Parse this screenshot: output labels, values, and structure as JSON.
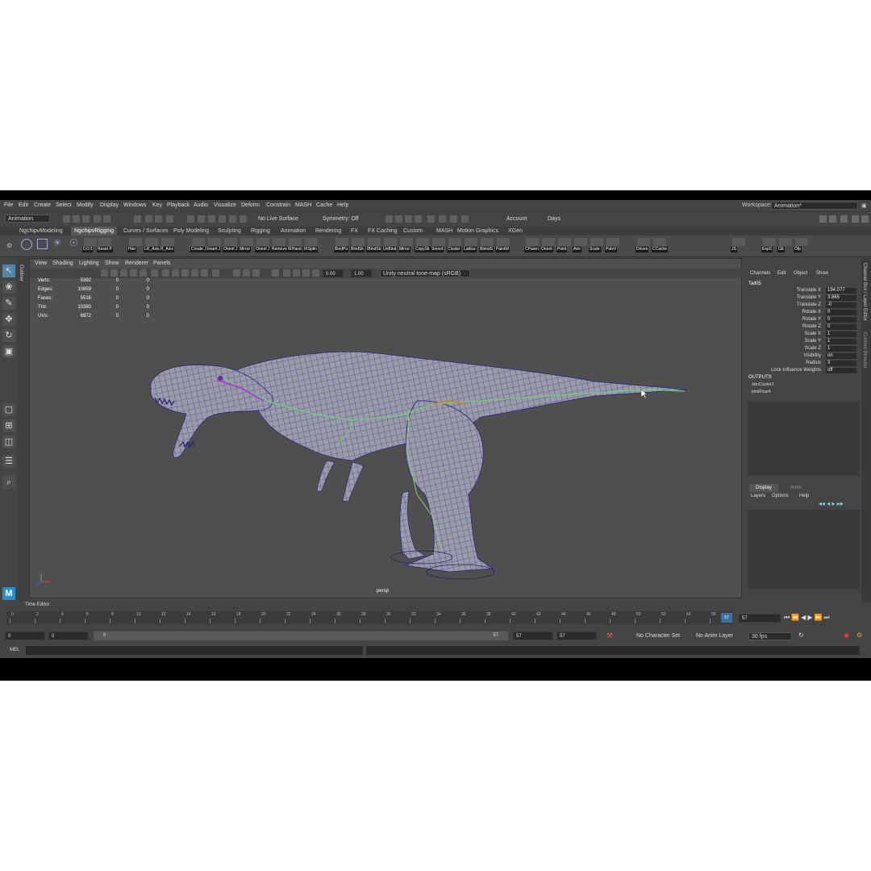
{
  "menu": [
    "File",
    "Edit",
    "Create",
    "Select",
    "Modify",
    "Display",
    "Windows",
    "Key",
    "Playback",
    "Audio",
    "Visualize",
    "Deform",
    "Constrain",
    "MASH",
    "Cache",
    "Help"
  ],
  "workspace": {
    "label": "Workspace:",
    "value": "Animation*"
  },
  "status": {
    "mode": "Animation",
    "live_surface": "No Live Surface",
    "symmetry": "Symmetry: Off",
    "account": "Account",
    "days": "Days"
  },
  "shelf_tabs": [
    "NgchipvModeling",
    "NgchipvRigging",
    "Curves / Surfaces",
    "Poly Modeling",
    "Sculpting",
    "Rigging",
    "Animation",
    "Rendering",
    "FX",
    "FX Caching",
    "Custom",
    "MASH",
    "Motion Graphics",
    "XGen"
  ],
  "shelf_active": 1,
  "shelf_buttons": [
    {
      "label": "0,0,0"
    },
    {
      "label": "Reset P"
    },
    {
      "label": "Hier"
    },
    {
      "label": "LR_Axis"
    },
    {
      "label": "R_Axis"
    },
    {
      "label": "Create J"
    },
    {
      "label": "Insert J"
    },
    {
      "label": "Orient J"
    },
    {
      "label": "Mirror"
    },
    {
      "label": "Orient J"
    },
    {
      "label": "Remove"
    },
    {
      "label": "IKHand"
    },
    {
      "label": "IKSplin"
    },
    {
      "label": "BindPo"
    },
    {
      "label": "BindSk"
    },
    {
      "label": "IBindSk"
    },
    {
      "label": "UnBind"
    },
    {
      "label": "Mirror"
    },
    {
      "label": "CopySk"
    },
    {
      "label": "Smoot"
    },
    {
      "label": "Cluster"
    },
    {
      "label": "Lattice"
    },
    {
      "label": "BlendS"
    },
    {
      "label": "PaintW"
    },
    {
      "label": "CParen"
    },
    {
      "label": "Orient"
    },
    {
      "label": "Point"
    },
    {
      "label": "Aim"
    },
    {
      "label": "Scale"
    },
    {
      "label": "PoleV"
    },
    {
      "label": "Driven"
    },
    {
      "label": "CCache"
    },
    {
      "label": "JS"
    },
    {
      "label": "ExpS"
    },
    {
      "label": "GE"
    },
    {
      "label": "Olp"
    }
  ],
  "viewport": {
    "menu": [
      "View",
      "Shading",
      "Lighting",
      "Show",
      "Renderer",
      "Panels"
    ],
    "exposure": "0.00",
    "gamma": "1.00",
    "colorspace": "Unity neutral tone-map (sRGB)",
    "camera": "persp",
    "hud": [
      {
        "label": "Verts:",
        "v1": "5392",
        "v2": "0",
        "v3": "0"
      },
      {
        "label": "Edges:",
        "v1": "10859",
        "v2": "0",
        "v3": "0"
      },
      {
        "label": "Faces:",
        "v1": "5516",
        "v2": "0",
        "v3": "0"
      },
      {
        "label": "Tris:",
        "v1": "10380",
        "v2": "0",
        "v3": "0"
      },
      {
        "label": "UVs:",
        "v1": "6972",
        "v2": "0",
        "v3": "0"
      }
    ]
  },
  "channel_box": {
    "menu": [
      "Channels",
      "Edit",
      "Object",
      "Show"
    ],
    "object": "Tail05",
    "attrs": [
      {
        "label": "Translate X",
        "value": "194.077"
      },
      {
        "label": "Translate Y",
        "value": "3.865"
      },
      {
        "label": "Translate Z",
        "value": "-0"
      },
      {
        "label": "Rotate X",
        "value": "0"
      },
      {
        "label": "Rotate Y",
        "value": "0"
      },
      {
        "label": "Rotate Z",
        "value": "0"
      },
      {
        "label": "Scale X",
        "value": "1"
      },
      {
        "label": "Scale Y",
        "value": "1"
      },
      {
        "label": "Scale Z",
        "value": "1"
      },
      {
        "label": "Visibility",
        "value": "on"
      },
      {
        "label": "Radius",
        "value": "3"
      },
      {
        "label": "Lock Influence Weights",
        "value": "off"
      }
    ],
    "outputs_label": "OUTPUTS",
    "outputs": [
      "skinCluster1",
      "bindPose4"
    ]
  },
  "layer_editor": {
    "tabs": [
      "Display",
      "Anim"
    ],
    "menu": [
      "Layers",
      "Options",
      "Help"
    ]
  },
  "side_tabs": [
    "Channel Box / Layer Editor",
    "Content Browser"
  ],
  "outliner_tab": "Outliner",
  "time_editor": "Time Editor",
  "timeline": {
    "ticks": [
      "0",
      "2",
      "4",
      "6",
      "8",
      "10",
      "12",
      "14",
      "16",
      "18",
      "20",
      "22",
      "24",
      "26",
      "28",
      "30",
      "32",
      "34",
      "36",
      "38",
      "40",
      "42",
      "44",
      "46",
      "48",
      "50",
      "52",
      "54",
      "56"
    ],
    "current": "57",
    "current_field": "57"
  },
  "range": {
    "start": "0",
    "inner_start": "0",
    "slider_start": "0",
    "slider_end": "57",
    "end": "57",
    "outer_end": "57",
    "character_set": "No Character Set",
    "anim_layer": "No Anim Layer",
    "fps": "30 fps"
  },
  "command": {
    "lang": "MEL"
  },
  "maya_logo": "M"
}
